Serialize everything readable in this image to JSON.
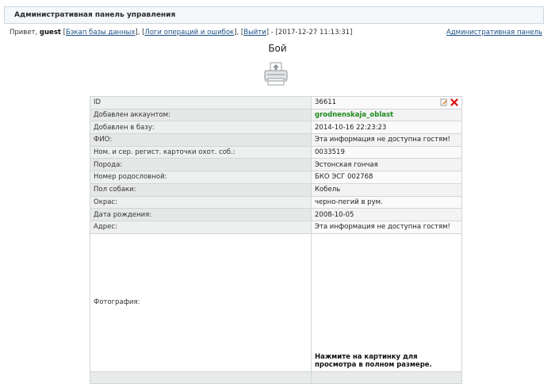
{
  "header": {
    "title": "Административная панель управления"
  },
  "greeting": {
    "prefix": "Привет,",
    "username": "guest",
    "links": [
      "Бэкап базы данных",
      "Логи операций и ошибок",
      "Выйти"
    ],
    "datetime": "2017-12-27 11:13:31",
    "admin_panel_link": "Административная панель"
  },
  "page_title": "Бой",
  "icons": {
    "print": "printer-icon",
    "edit": "edit-icon",
    "delete": "delete-icon"
  },
  "colors": {
    "account_green": "#1e8a1e",
    "link_blue": "#1a4e86"
  },
  "record": {
    "rows": [
      {
        "label": "ID",
        "value": "36611"
      },
      {
        "label": "Добавлен аккаунтом:",
        "value": "grodnenskaja_oblast"
      },
      {
        "label": "Добавлен в базу:",
        "value": "2014-10-16 22:23:23"
      },
      {
        "label": "ФИО:",
        "value": "Эта информация не доступна гостям!"
      },
      {
        "label": "Ном. и сер. регист. карточки охот. соб.:",
        "value": "0033519"
      },
      {
        "label": "Порода:",
        "value": "Эстонская гончая"
      },
      {
        "label": "Номер родословной:",
        "value": "БКО ЭСГ 002768"
      },
      {
        "label": "Пол собаки:",
        "value": "Кобель"
      },
      {
        "label": "Окрас:",
        "value": "черно-пегий в рум."
      },
      {
        "label": "Дата рождения:",
        "value": "2008-10-05"
      },
      {
        "label": "Адрес:",
        "value": "Эта информация не доступна гостям!"
      }
    ],
    "photo": {
      "label": "Фотография:",
      "hint": "Нажмите на картинку для просмотра в полном размере."
    }
  }
}
